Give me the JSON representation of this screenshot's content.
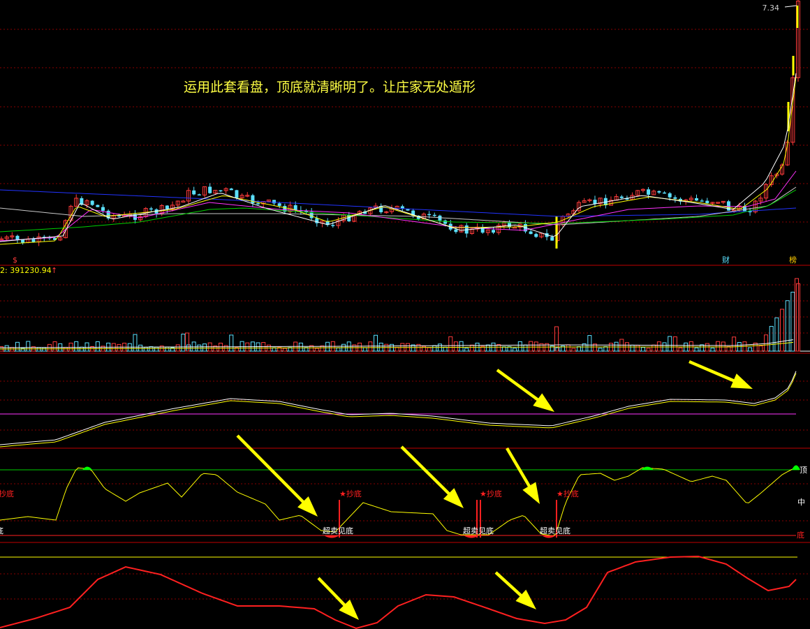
{
  "annotation": "运用此套看盘，顶底就清晰明了。让庄家无处遁形",
  "price_label": "7.34",
  "volume_label": "2: 391230.94",
  "volume_arrow": "↑",
  "marks": {
    "dollar": "$",
    "cai": "财",
    "bang": "榜"
  },
  "osc": {
    "top": "顶",
    "mid": "中",
    "bottom": "底",
    "left_cut_buy": "抄底",
    "left_cut_bottom": "底",
    "buy": "★抄底",
    "oversold": "超卖见底"
  },
  "colors": {
    "bg": "#000000",
    "up": "#ff3b3b",
    "down": "#5ce1ff",
    "yellow": "#ffff00",
    "white": "#ffffff",
    "magenta": "#ff33ff",
    "green": "#00d000",
    "blue": "#2233ff",
    "red": "#ff2020",
    "grid": "#8a0000",
    "signal_green": "#00ff00"
  },
  "chart_data": {
    "type": "line",
    "candle_count": 150,
    "price_last": 7.34,
    "volume_last": 391230.94,
    "oscillator_levels": [
      "顶",
      "中",
      "底"
    ],
    "buy_signals": 3,
    "oversold_signals": 3
  }
}
